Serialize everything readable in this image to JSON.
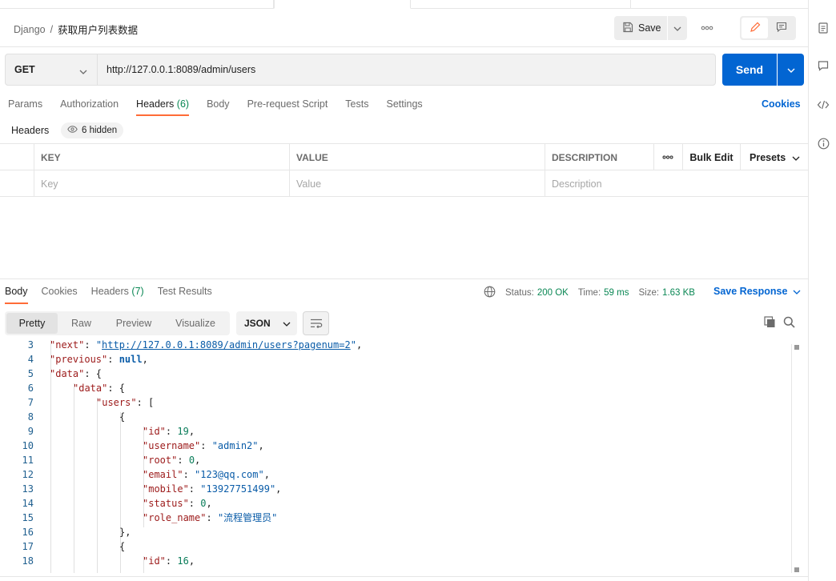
{
  "breadcrumb": {
    "collection": "Django",
    "separator": "/",
    "request": "获取用户列表数据"
  },
  "toolbar": {
    "save_label": "Save"
  },
  "request": {
    "method": "GET",
    "url": "http://127.0.0.1:8089/admin/users",
    "send_label": "Send"
  },
  "request_tabs": [
    {
      "label": "Params"
    },
    {
      "label": "Authorization"
    },
    {
      "label": "Headers",
      "count": "(6)"
    },
    {
      "label": "Body"
    },
    {
      "label": "Pre-request Script"
    },
    {
      "label": "Tests"
    },
    {
      "label": "Settings"
    }
  ],
  "cookies_label": "Cookies",
  "headers": {
    "label": "Headers",
    "hidden": "6 hidden",
    "columns": {
      "key": "KEY",
      "value": "VALUE",
      "description": "DESCRIPTION"
    },
    "bulk_edit": "Bulk Edit",
    "presets": "Presets",
    "placeholder": {
      "key": "Key",
      "value": "Value",
      "description": "Description"
    }
  },
  "response_tabs": [
    {
      "label": "Body"
    },
    {
      "label": "Cookies"
    },
    {
      "label": "Headers",
      "count": "(7)"
    },
    {
      "label": "Test Results"
    }
  ],
  "response_status": {
    "status_label": "Status:",
    "status_value": "200 OK",
    "time_label": "Time:",
    "time_value": "59 ms",
    "size_label": "Size:",
    "size_value": "1.63 KB",
    "save_response": "Save Response"
  },
  "view_tabs": [
    "Pretty",
    "Raw",
    "Preview",
    "Visualize"
  ],
  "format": "JSON",
  "code_lines": [
    {
      "n": "3",
      "text": "\"next\": \"http://127.0.0.1:8089/admin/users?pagenum=2\","
    },
    {
      "n": "4",
      "text": "\"previous\": null,"
    },
    {
      "n": "5",
      "text": "\"data\": {"
    },
    {
      "n": "6",
      "text": "\"data\": {"
    },
    {
      "n": "7",
      "text": "\"users\": ["
    },
    {
      "n": "8",
      "text": "{"
    },
    {
      "n": "9",
      "text": "\"id\": 19,"
    },
    {
      "n": "10",
      "text": "\"username\": \"admin2\","
    },
    {
      "n": "11",
      "text": "\"root\": 0,"
    },
    {
      "n": "12",
      "text": "\"email\": \"123@qq.com\","
    },
    {
      "n": "13",
      "text": "\"mobile\": \"13927751499\","
    },
    {
      "n": "14",
      "text": "\"status\": 0,"
    },
    {
      "n": "15",
      "text": "\"role_name\": \"流程管理员\""
    },
    {
      "n": "16",
      "text": "},"
    },
    {
      "n": "17",
      "text": "{"
    },
    {
      "n": "18",
      "text": "\"id\": 16,"
    }
  ],
  "colors": {
    "accent_orange": "#ff6c37",
    "primary_blue": "#0265d2",
    "success_green": "#0a8754"
  }
}
